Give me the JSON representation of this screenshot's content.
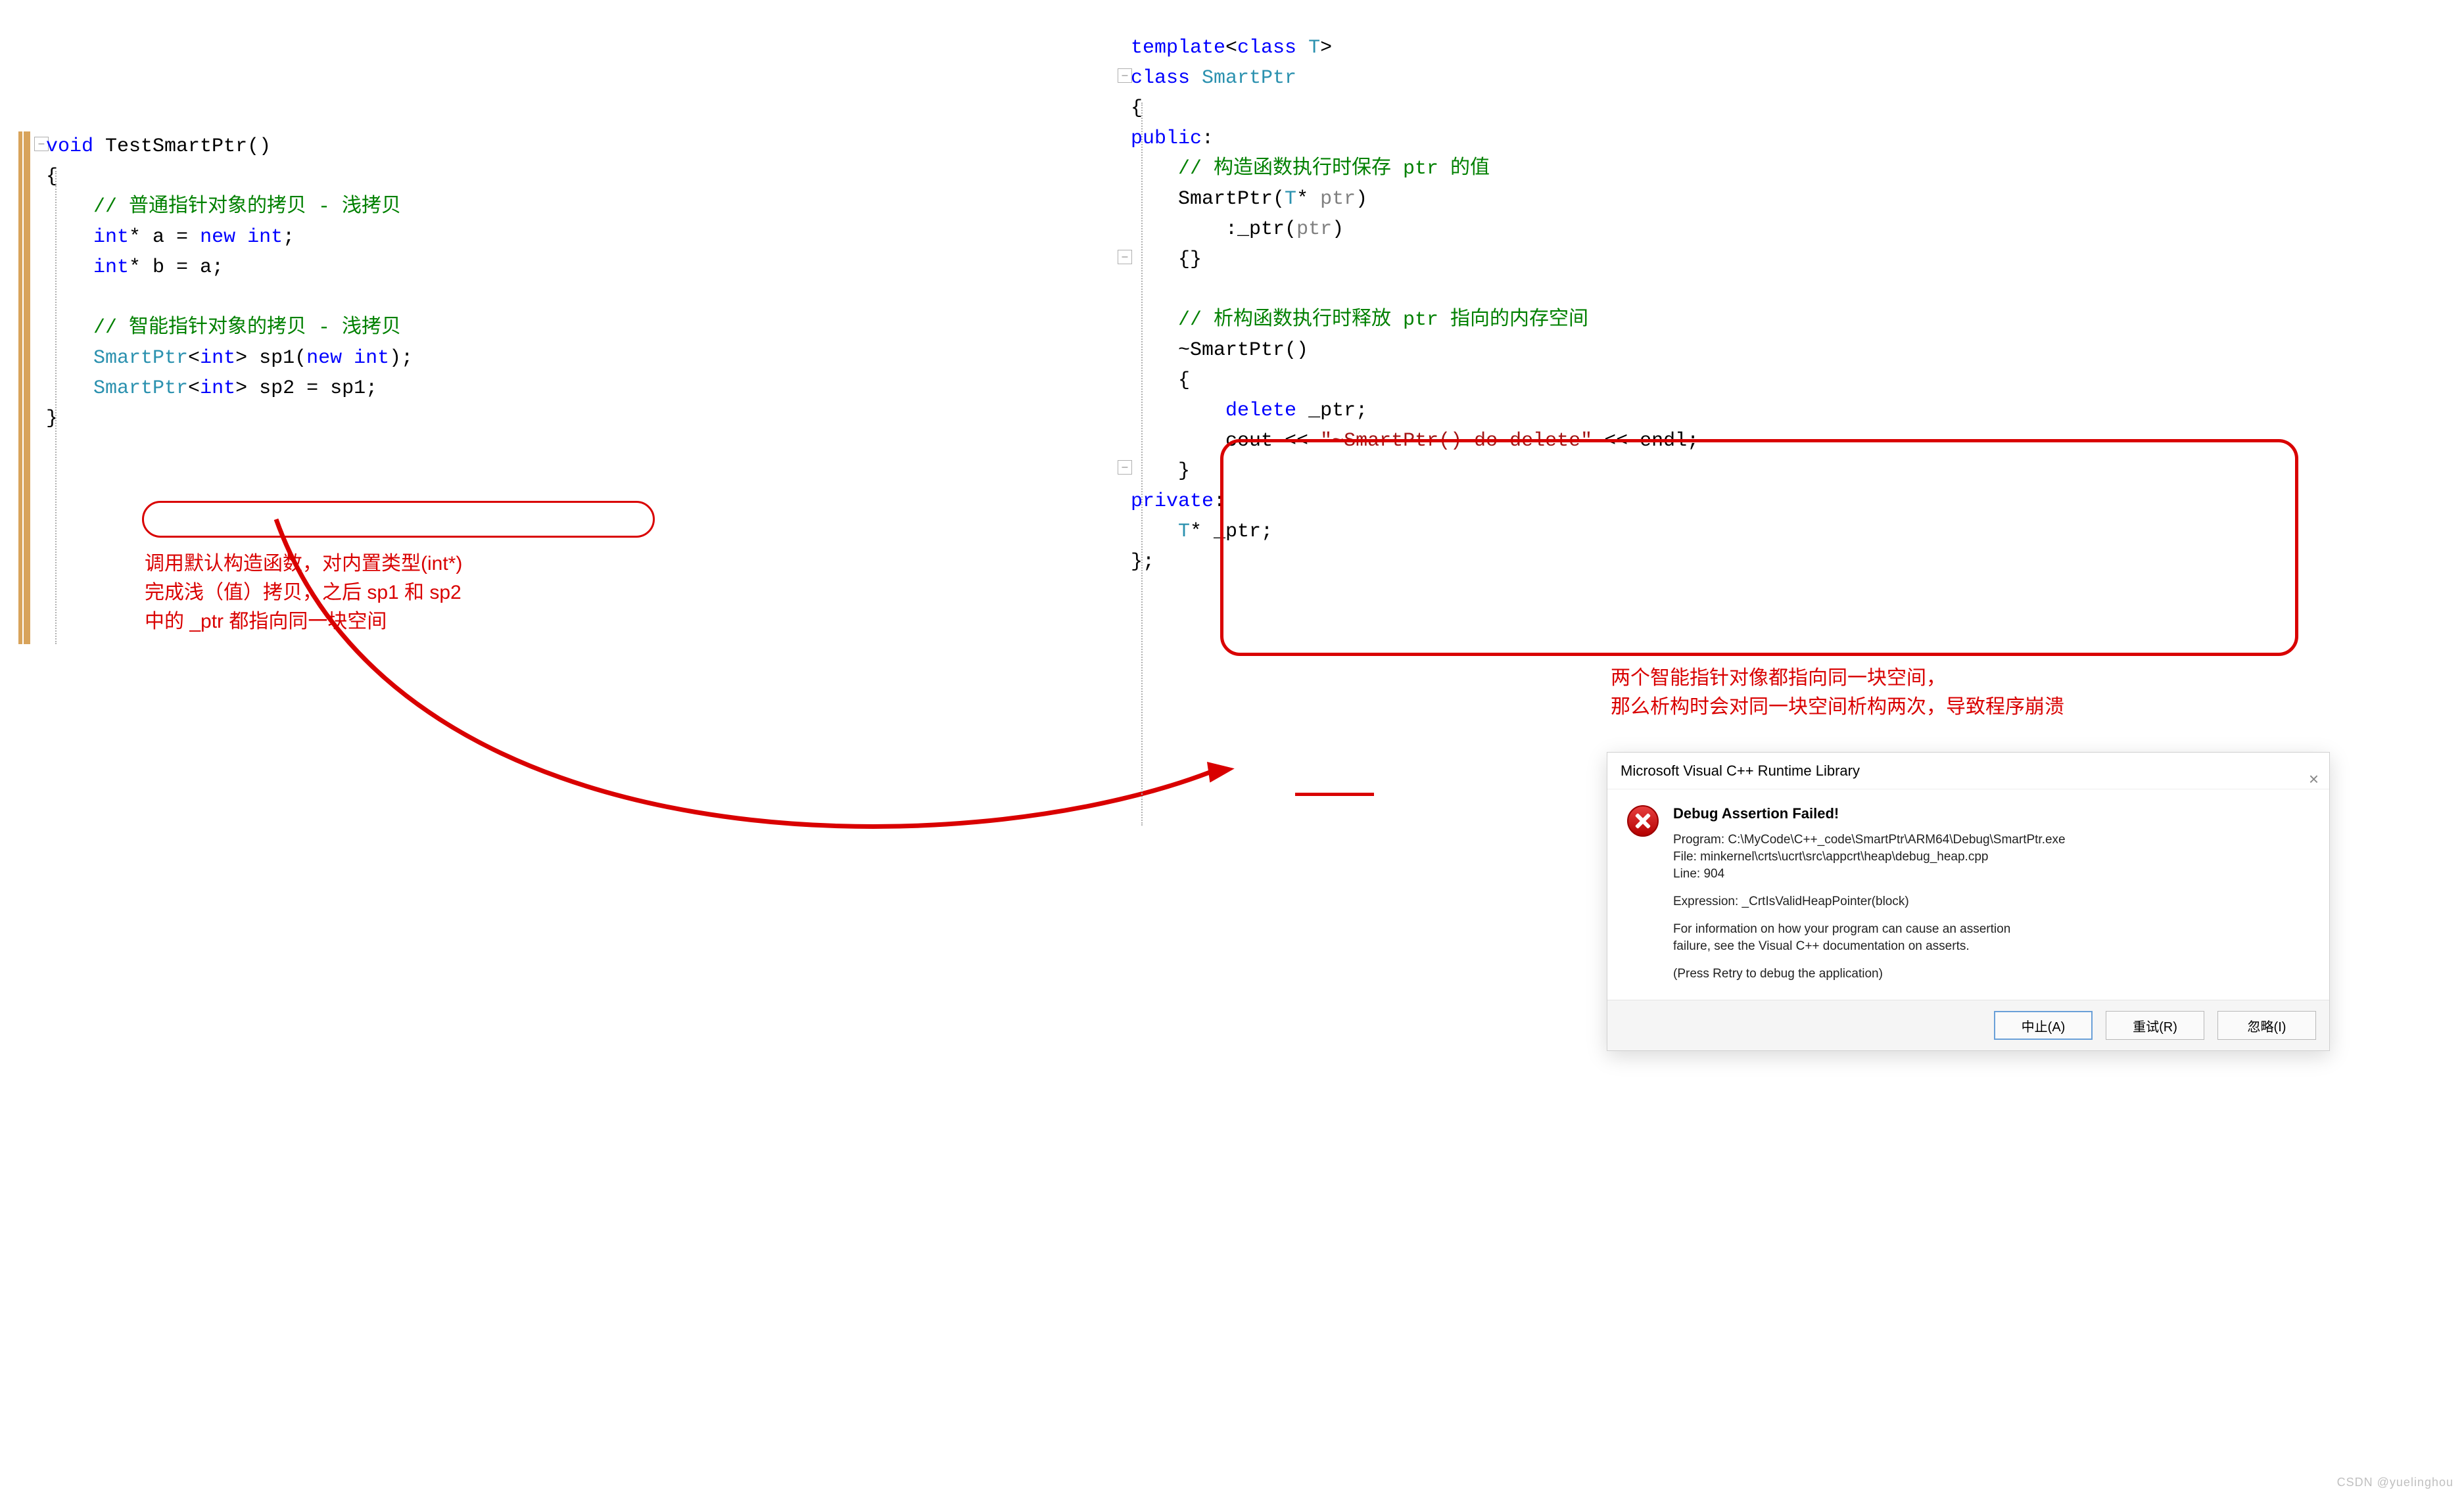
{
  "left": {
    "line1": {
      "kw_void": "void",
      "fn": "TestSmartPtr",
      "paren": "()"
    },
    "lbrace": "{",
    "c1": "// 普通指针对象的拷贝 - 浅拷贝",
    "l2a": "int",
    "l2b": "* a = ",
    "l2c": "new ",
    "l2d": "int",
    "l2e": ";",
    "l3a": "int",
    "l3b": "* b = a;",
    "c2": "// 智能指针对象的拷贝 - 浅拷贝",
    "l4a": "SmartPtr",
    "l4b": "<",
    "l4c": "int",
    "l4d": "> sp1(",
    "l4e": "new ",
    "l4f": "int",
    "l4g": ");",
    "l5a": "SmartPtr",
    "l5b": "<",
    "l5c": "int",
    "l5d": "> sp2 = sp1;",
    "rbrace": "}"
  },
  "right": {
    "t1a": "template",
    "t1b": "<",
    "t1c": "class ",
    "t1d": "T",
    "t1e": ">",
    "c1a": "class ",
    "c1b": "SmartPtr",
    "lbrace": "{",
    "pub": "public",
    "colon": ":",
    "cm_ctor": "// 构造函数执行时保存 ptr 的值",
    "ctor_a": "SmartPtr(",
    "ctor_b": "T",
    "ctor_c": "* ",
    "ctor_d": "ptr",
    "ctor_e": ")",
    "init": ":_ptr(",
    "init2": "ptr",
    "init3": ")",
    "ctor_body": "{}",
    "cm_dtor": "// 析构函数执行时释放 ptr 指向的内存空间",
    "dtor_name": "~SmartPtr()",
    "dtor_l": "{",
    "del": "delete",
    "del2": " _ptr;",
    "cout": "cout << ",
    "str": "\"~SmartPtr() do delete\"",
    "endl": " << endl;",
    "dtor_r": "}",
    "priv": "private",
    "ptr_a": "T",
    "ptr_b": "* _ptr;",
    "end": "};"
  },
  "anno": {
    "left_l1": "调用默认构造函数，对内置类型(int*)",
    "left_l2": "完成浅（值）拷贝，之后 sp1 和 sp2",
    "left_l3": "中的 _ptr 都指向同一块空间",
    "right_l1": "两个智能指针对像都指向同一块空间，",
    "right_l2": "那么析构时会对同一块空间析构两次，导致程序崩溃"
  },
  "dialog": {
    "title": "Microsoft Visual C++ Runtime Library",
    "heading": "Debug Assertion Failed!",
    "program": "Program: C:\\MyCode\\C++_code\\SmartPtr\\ARM64\\Debug\\SmartPtr.exe",
    "file": "File: minkernel\\crts\\ucrt\\src\\appcrt\\heap\\debug_heap.cpp",
    "line": "Line: 904",
    "expr": "Expression: _CrtIsValidHeapPointer(block)",
    "info1": "For information on how your program can cause an assertion",
    "info2": "failure, see the Visual C++ documentation on asserts.",
    "retry": "(Press Retry to debug the application)",
    "btn_abort": "中止(A)",
    "btn_retry": "重试(R)",
    "btn_ignore": "忽略(I)"
  },
  "watermark": "CSDN @yuelinghou"
}
